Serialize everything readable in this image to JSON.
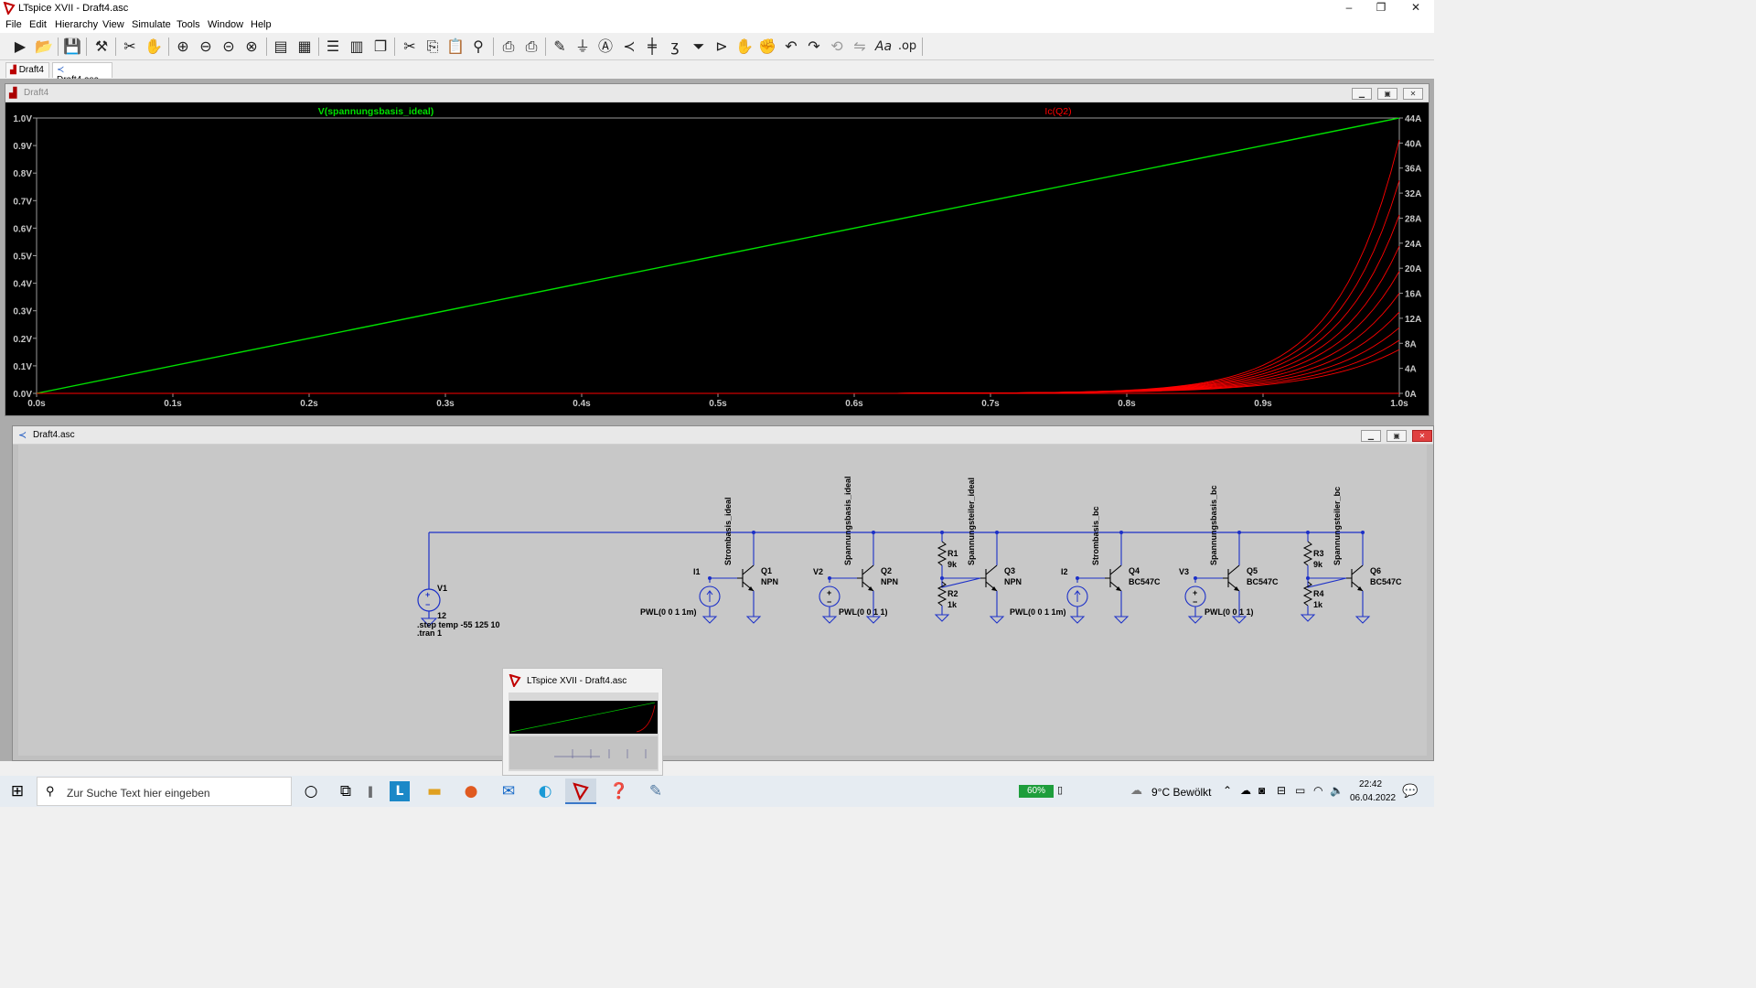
{
  "window": {
    "title": "LTspice XVII - Draft4.asc",
    "min_glyph": "–",
    "max_glyph": "❐",
    "close_glyph": "✕"
  },
  "menu": [
    "File",
    "Edit",
    "Hierarchy",
    "View",
    "Simulate",
    "Tools",
    "Window",
    "Help"
  ],
  "toolbar": {
    "buttons": [
      "run-icon",
      "open-icon",
      "save-icon",
      "control-panel-icon",
      "halt-icon",
      "pan-icon",
      "zoom-in-icon",
      "zoom-out-icon",
      "zoom-back-icon",
      "zoom-fit-icon",
      "autorange-icon",
      "grid-icon",
      "tile-horizontal-icon",
      "tile-vertical-icon",
      "cascade-icon",
      "cut-icon",
      "copy-icon",
      "paste-icon",
      "find-icon",
      "print-icon",
      "print-preview-icon",
      "wire-icon",
      "ground-icon",
      "label-net-icon",
      "resistor-icon",
      "capacitor-icon",
      "inductor-icon",
      "diode-icon",
      "component-icon",
      "move-icon",
      "drag-icon",
      "undo-icon",
      "redo-icon",
      "rotate-icon",
      "mirror-icon",
      "text-icon",
      "spice-directive-icon"
    ],
    "text_aa": "Aa",
    "text_op": ".op"
  },
  "tabs": [
    "Draft4",
    "Draft4.asc"
  ],
  "plot_window": {
    "title": "Draft4",
    "trace_left_label": "V(spannungsbasis_ideal)",
    "trace_right_label": "Ic(Q2)",
    "trace_left_color": "#00e000",
    "trace_right_color": "#ff0000"
  },
  "chart_data": {
    "type": "line",
    "title": "",
    "xlabel": "",
    "x_ticks": [
      "0.0s",
      "0.1s",
      "0.2s",
      "0.3s",
      "0.4s",
      "0.5s",
      "0.6s",
      "0.7s",
      "0.8s",
      "0.9s",
      "1.0s"
    ],
    "xlim": [
      0,
      1.0
    ],
    "y_left_ticks": [
      "1.0V",
      "0.9V",
      "0.8V",
      "0.7V",
      "0.6V",
      "0.5V",
      "0.4V",
      "0.3V",
      "0.2V",
      "0.1V",
      "0.0V"
    ],
    "ylim_left": [
      0,
      1.0
    ],
    "y_right_ticks": [
      "44A",
      "40A",
      "36A",
      "32A",
      "28A",
      "24A",
      "20A",
      "16A",
      "12A",
      "8A",
      "4A",
      "0A"
    ],
    "ylim_right": [
      0,
      44
    ],
    "grid": false,
    "background": "#000000",
    "series": [
      {
        "name": "V(spannungsbasis_ideal)",
        "axis": "left",
        "color": "#00e000",
        "x": [
          0,
          1.0
        ],
        "y": [
          0,
          1.0
        ]
      },
      {
        "name": "Ic(Q2)",
        "axis": "right",
        "color": "#ff0000",
        "stepped": true,
        "x": [
          0,
          0.8,
          0.85,
          0.9,
          0.93,
          0.96,
          0.98,
          1.0
        ],
        "families_peak": [
          40.5,
          34.0,
          28.5,
          23.5,
          19.5,
          16.0,
          13.0,
          10.5,
          8.5,
          7.0
        ]
      }
    ]
  },
  "schematic_window": {
    "title": "Draft4.asc",
    "labels": {
      "v1_name": "V1",
      "v1_value": "12",
      "step": ".step temp -55 125 10",
      "tran": ".tran 1",
      "i1": "I1",
      "i1_val": "PWL(0 0 1 1m)",
      "q1": "Q1",
      "q1_model": "NPN",
      "net1": "Strombasis_ideal",
      "v2": "V2",
      "v2_val": "PWL(0 0 1 1)",
      "q2": "Q2",
      "q2_model": "NPN",
      "net2": "Spannungsbasis_ideal",
      "r1": "R1",
      "r1_val": "9k",
      "r2": "R2",
      "r2_val": "1k",
      "q3": "Q3",
      "q3_model": "NPN",
      "q3_val": "PWL(0 0 1 1m)",
      "net3": "Spannungsteiler_ideal",
      "i2": "I2",
      "q4": "Q4",
      "q4_model": "BC547C",
      "net4": "Strombasis_bc",
      "v3": "V3",
      "v3_val": "PWL(0 0 1 1)",
      "q5": "Q5",
      "q5_model": "BC547C",
      "net5": "Spannungsbasis_bc",
      "r3": "R3",
      "r3_val": "9k",
      "r4": "R4",
      "r4_val": "1k",
      "q6": "Q6",
      "q6_model": "BC547C",
      "net6": "Spannungsteiler_bc"
    }
  },
  "preview_thumbnail": {
    "title": "LTspice XVII - Draft4.asc"
  },
  "taskbar": {
    "search_placeholder": "Zur Suche Text hier eingeben",
    "battery": "60%",
    "weather": "9°C  Bewölkt",
    "time": "22:42",
    "date": "06.04.2022",
    "apps": [
      "windows-start-icon",
      "cortana-icon",
      "task-view-icon",
      "divider",
      "lyx-icon",
      "file-explorer-icon",
      "firefox-icon",
      "mail-icon",
      "edge-icon",
      "ltspice-icon",
      "help-icon",
      "paint-icon"
    ]
  }
}
